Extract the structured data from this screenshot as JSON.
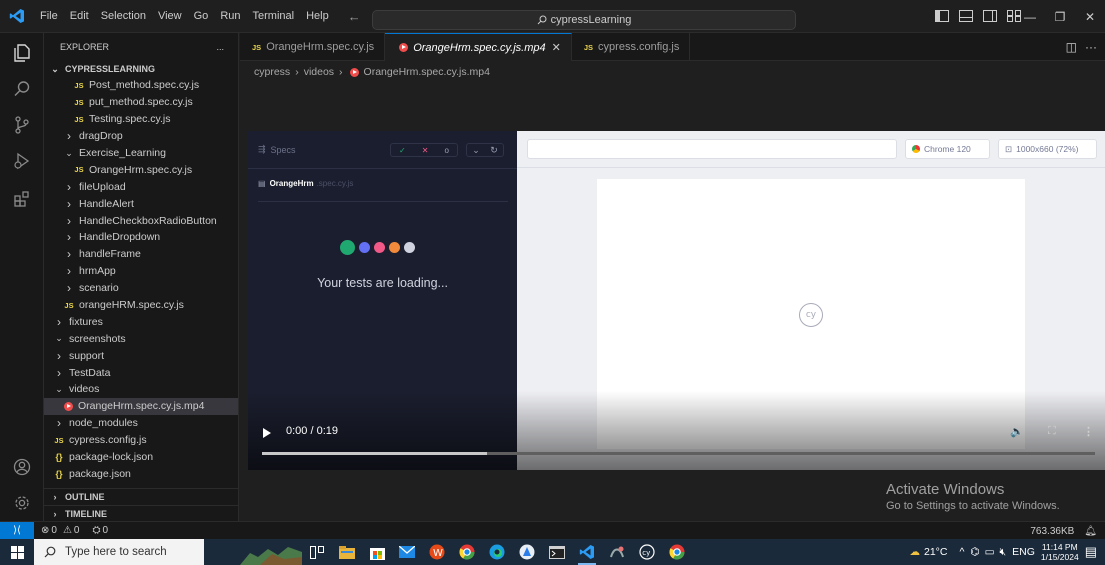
{
  "window": {
    "menu": [
      "File",
      "Edit",
      "Selection",
      "View",
      "Go",
      "Run",
      "Terminal",
      "Help"
    ],
    "command_center": "cypressLearning"
  },
  "explorer": {
    "title": "EXPLORER",
    "more": "...",
    "root": "CYPRESSLEARNING",
    "items": [
      {
        "label": "Post_method.spec.cy.js",
        "icon": "js",
        "indent": 2
      },
      {
        "label": "put_method.spec.cy.js",
        "icon": "js",
        "indent": 2
      },
      {
        "label": "Testing.spec.cy.js",
        "icon": "js",
        "indent": 2
      },
      {
        "label": "dragDrop",
        "icon": "chevron-right",
        "indent": 1
      },
      {
        "label": "Exercise_Learning",
        "icon": "chevron-down",
        "indent": 1
      },
      {
        "label": "OrangeHrm.spec.cy.js",
        "icon": "js",
        "indent": 2
      },
      {
        "label": "fileUpload",
        "icon": "chevron-right",
        "indent": 1
      },
      {
        "label": "HandleAlert",
        "icon": "chevron-right",
        "indent": 1
      },
      {
        "label": "HandleCheckboxRadioButton",
        "icon": "chevron-right",
        "indent": 1
      },
      {
        "label": "HandleDropdown",
        "icon": "chevron-right",
        "indent": 1
      },
      {
        "label": "handleFrame",
        "icon": "chevron-right",
        "indent": 1
      },
      {
        "label": "hrmApp",
        "icon": "chevron-right",
        "indent": 1
      },
      {
        "label": "scenario",
        "icon": "chevron-right",
        "indent": 1
      },
      {
        "label": "orangeHRM.spec.cy.js",
        "icon": "js",
        "indent": 1
      },
      {
        "label": "fixtures",
        "icon": "chevron-right",
        "indent": 0
      },
      {
        "label": "screenshots",
        "icon": "chevron-down",
        "indent": 0
      },
      {
        "label": "support",
        "icon": "chevron-right",
        "indent": 0
      },
      {
        "label": "TestData",
        "icon": "chevron-right",
        "indent": 0
      },
      {
        "label": "videos",
        "icon": "chevron-down",
        "indent": 0
      },
      {
        "label": "OrangeHrm.spec.cy.js.mp4",
        "icon": "cypress-video",
        "indent": 1,
        "selected": true
      },
      {
        "label": "node_modules",
        "icon": "chevron-right",
        "indent": 0
      },
      {
        "label": "cypress.config.js",
        "icon": "js",
        "indent": 0
      },
      {
        "label": "package-lock.json",
        "icon": "json",
        "indent": 0
      },
      {
        "label": "package.json",
        "icon": "json",
        "indent": 0
      }
    ],
    "outline": "OUTLINE",
    "timeline": "TIMELINE"
  },
  "tabs": [
    {
      "label": "OrangeHrm.spec.cy.js",
      "icon": "js"
    },
    {
      "label": "OrangeHrm.spec.cy.js.mp4",
      "icon": "cypress-video",
      "active": true
    },
    {
      "label": "cypress.config.js",
      "icon": "js"
    }
  ],
  "breadcrumb": [
    "cypress",
    "videos",
    "OrangeHrm.spec.cy.js.mp4"
  ],
  "video": {
    "specs_label": "Specs",
    "spec_name": "OrangeHrm",
    "spec_ext": ".spec.cy.js",
    "loading_text": "Your tests are loading...",
    "browser": "Chrome 120",
    "viewport": "1000x660 (72%)",
    "cy_logo_text": "cy",
    "time": "0:00 / 0:19",
    "progress": 0.27,
    "dot_colors": [
      "#1fa971",
      "#6470f3",
      "#f15988",
      "#f18b3b",
      "#d0d2e0"
    ]
  },
  "activation": {
    "title": "Activate Windows",
    "subtitle": "Go to Settings to activate Windows."
  },
  "statusbar": {
    "errors": "0",
    "warnings": "0",
    "ports": "0",
    "file_size": "763.36KB"
  },
  "taskbar": {
    "search_placeholder": "Type here to search",
    "temperature": "21°C",
    "language": "ENG",
    "time": "11:14 PM",
    "date": "1/15/2024"
  }
}
